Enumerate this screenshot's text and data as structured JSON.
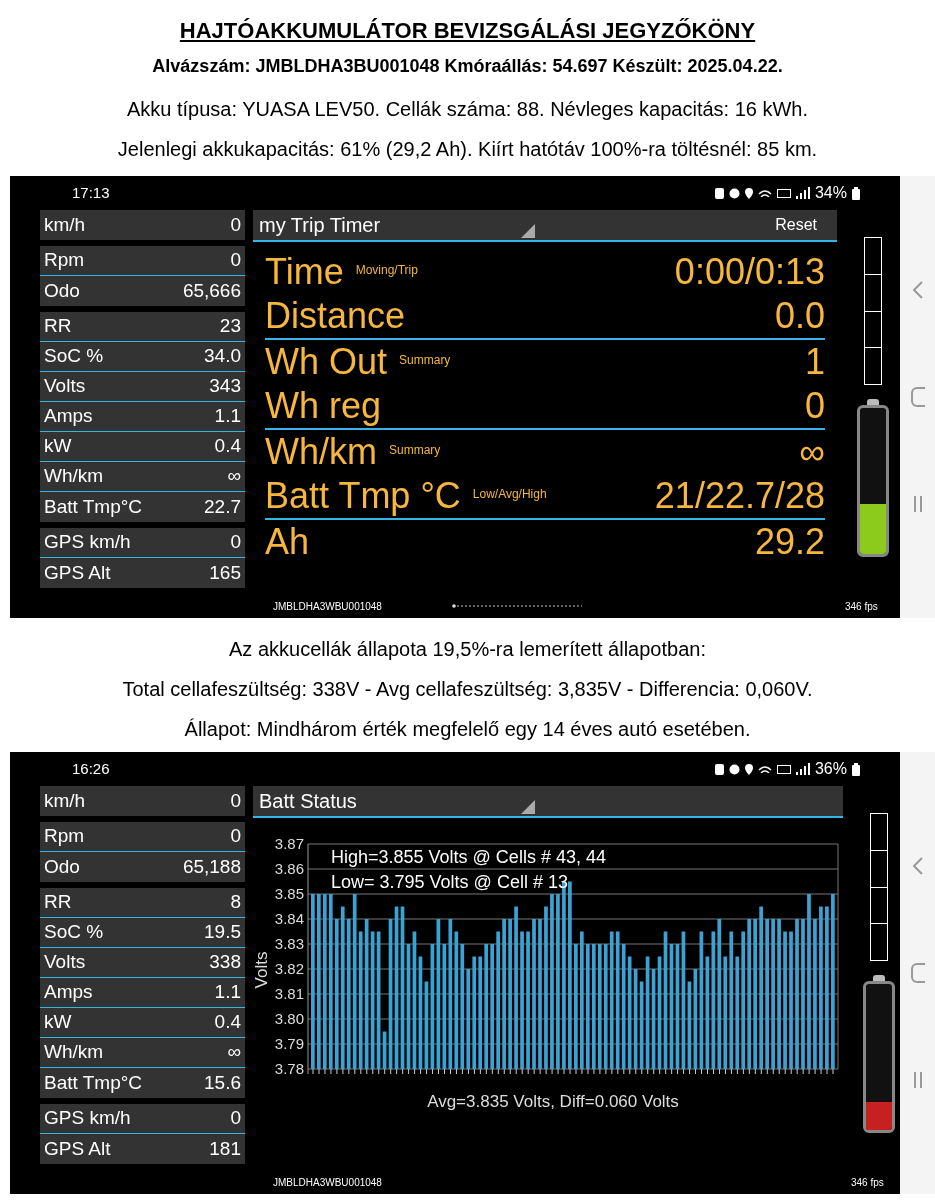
{
  "title": "HAJTÓAKKUMULÁTOR BEVIZSGÁLÁSI JEGYZŐKÖNY",
  "subtitle": "Alvázszám: JMBLDHA3BU001048 Kmóraállás: 54.697 Készült: 2025.04.22.",
  "intro": [
    "Akku típusa: YUASA LEV50. Cellák száma: 88. Névleges kapacitás: 16 kWh.",
    "Jelenlegi akkukapacitás: 61% (29,2 Ah). Kiírt hatótáv 100%-ra töltésnél: 85 km."
  ],
  "screens": [
    {
      "kind": "metrics",
      "time": "17:13",
      "battery_percent": "34%",
      "header": {
        "title": "my Trip Timer",
        "button": "Reset"
      },
      "sidebar": [
        [
          {
            "label": "km/h",
            "value": "0"
          }
        ],
        [
          {
            "label": "Rpm",
            "value": "0"
          },
          {
            "label": "Odo",
            "value": "65,666"
          }
        ],
        [
          {
            "label": "RR",
            "value": "23"
          },
          {
            "label": "SoC %",
            "value": "34.0"
          },
          {
            "label": "Volts",
            "value": "343"
          },
          {
            "label": "Amps",
            "value": "1.1"
          },
          {
            "label": "kW",
            "value": "0.4"
          },
          {
            "label": "Wh/km",
            "value": "∞"
          },
          {
            "label": "Batt Tmp°C",
            "value": "22.7"
          }
        ],
        [
          {
            "label": "GPS km/h",
            "value": "0"
          },
          {
            "label": "GPS Alt",
            "value": "165"
          }
        ]
      ],
      "metrics": [
        [
          {
            "label": "Time",
            "note": "Moving/Trip",
            "value": "0:00/0:13"
          },
          {
            "label": "Distance",
            "value": "0.0"
          }
        ],
        [
          {
            "label": "Wh Out",
            "note": "Summary",
            "value": "1"
          },
          {
            "label": "Wh reg",
            "value": "0"
          }
        ],
        [
          {
            "label": "Wh/km",
            "note": "Summary",
            "value": "∞"
          },
          {
            "label": "Batt Tmp °C",
            "note": "Low/Avg/High",
            "value": "21/22.7/28"
          }
        ],
        [
          {
            "label": "Ah",
            "value": "29.2"
          }
        ]
      ],
      "vin": "JMBLDHA3WBU001048",
      "fps": "346 fps",
      "battery": {
        "level": 0.34,
        "color": "#8ccb1c"
      }
    },
    {
      "kind": "chart",
      "time": "16:26",
      "battery_percent": "36%",
      "header": {
        "title": "Batt Status"
      },
      "sidebar": [
        [
          {
            "label": "km/h",
            "value": "0"
          }
        ],
        [
          {
            "label": "Rpm",
            "value": "0"
          },
          {
            "label": "Odo",
            "value": "65,188"
          }
        ],
        [
          {
            "label": "RR",
            "value": "8"
          },
          {
            "label": "SoC %",
            "value": "19.5"
          },
          {
            "label": "Volts",
            "value": "338"
          },
          {
            "label": "Amps",
            "value": "1.1"
          },
          {
            "label": "kW",
            "value": "0.4"
          },
          {
            "label": "Wh/km",
            "value": "∞"
          },
          {
            "label": "Batt Tmp°C",
            "value": "15.6"
          }
        ],
        [
          {
            "label": "GPS km/h",
            "value": "0"
          },
          {
            "label": "GPS Alt",
            "value": "181"
          }
        ]
      ],
      "chart_data": {
        "type": "bar",
        "xlabel": "Avg=3.835 Volts, Diff=0.060 Volts",
        "ylabel": "Volts",
        "ylim": [
          3.78,
          3.87
        ],
        "grid": true,
        "yticks": [
          {
            "value": 3.78,
            "label": "3.78"
          },
          {
            "value": 3.79,
            "label": "3.79"
          },
          {
            "value": 3.8,
            "label": "3.80"
          },
          {
            "value": 3.81,
            "label": "3.81"
          },
          {
            "value": 3.82,
            "label": "3.82"
          },
          {
            "value": 3.83,
            "label": "3.83"
          },
          {
            "value": 3.84,
            "label": "3.84"
          },
          {
            "value": 3.85,
            "label": "3.85"
          },
          {
            "value": 3.86,
            "label": "3.86"
          },
          {
            "value": 3.87,
            "label": "3.87"
          }
        ],
        "annotations": [
          "High=3.855 Volts @ Cells # 43, 44",
          "Low= 3.795 Volts @ Cell # 13"
        ],
        "series": [
          {
            "color": "#3ba3d3",
            "values": [
              3.85,
              3.85,
              3.85,
              3.85,
              3.84,
              3.845,
              3.84,
              3.85,
              3.835,
              3.84,
              3.835,
              3.835,
              3.795,
              3.84,
              3.845,
              3.845,
              3.83,
              3.835,
              3.825,
              3.815,
              3.83,
              3.84,
              3.83,
              3.84,
              3.835,
              3.83,
              3.82,
              3.825,
              3.825,
              3.83,
              3.83,
              3.835,
              3.84,
              3.84,
              3.845,
              3.835,
              3.835,
              3.84,
              3.84,
              3.845,
              3.85,
              3.85,
              3.855,
              3.855,
              3.83,
              3.835,
              3.83,
              3.83,
              3.83,
              3.83,
              3.835,
              3.835,
              3.83,
              3.825,
              3.82,
              3.815,
              3.825,
              3.82,
              3.825,
              3.835,
              3.83,
              3.83,
              3.835,
              3.815,
              3.82,
              3.835,
              3.825,
              3.835,
              3.84,
              3.825,
              3.835,
              3.825,
              3.835,
              3.84,
              3.84,
              3.845,
              3.84,
              3.84,
              3.84,
              3.835,
              3.835,
              3.84,
              3.84,
              3.85,
              3.84,
              3.845,
              3.845,
              3.85
            ]
          }
        ]
      },
      "vin": "JMBLDHA3WBU001048",
      "fps": "346 fps",
      "battery": {
        "level": 0.195,
        "color": "#c62020"
      }
    }
  ],
  "middle": [
    "Az akkucellák állapota 19,5%-ra lemerített állapotban:",
    "Total cellafeszültség: 338V -  Avg cellafeszültség: 3,835V - Differencia: 0,060V.",
    "Állapot: Mindhárom érték megfelelő egy 14 éves autó esetében."
  ]
}
